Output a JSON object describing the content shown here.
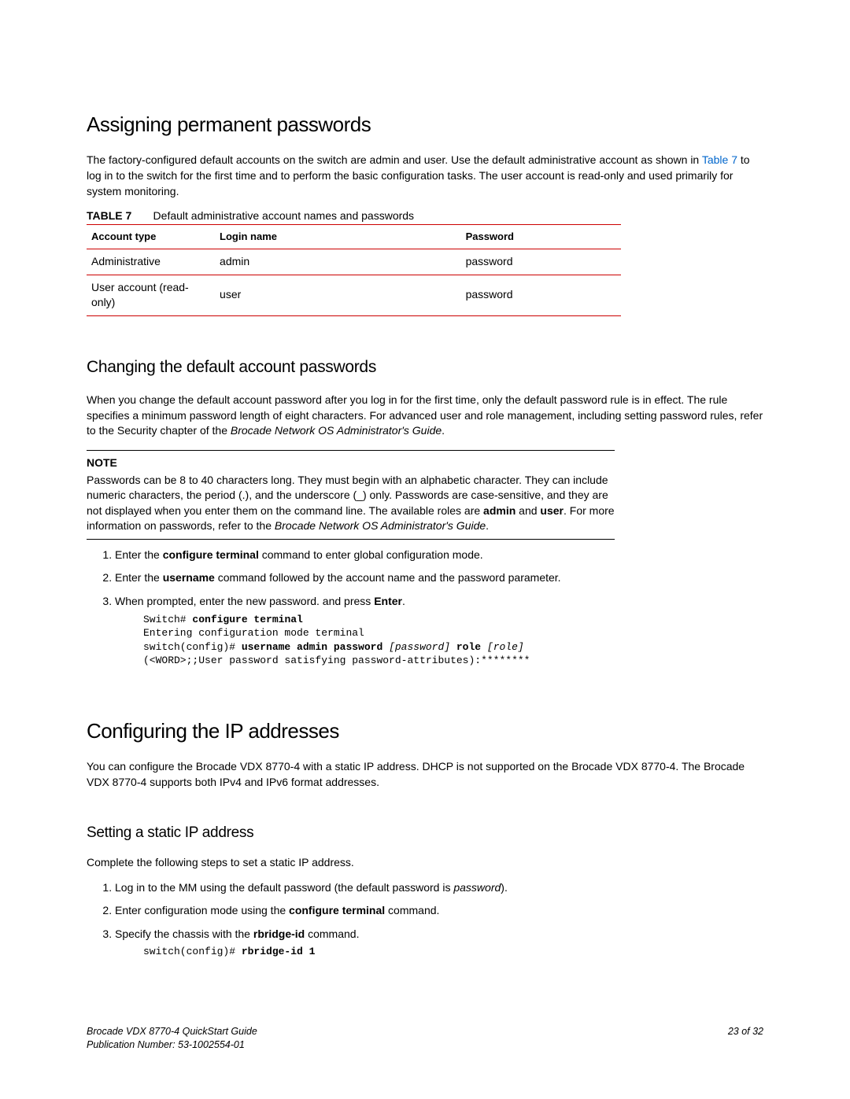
{
  "h1_a": "Assigning permanent passwords",
  "p1_a": "The factory-configured default accounts on the switch are admin and user. Use the default administrative account as shown in ",
  "p1_link": "Table 7",
  "p1_b": " to log in to the switch for the first time and to perform the basic configuration tasks. The user account is read-only and used primarily for system monitoring.",
  "table": {
    "label": "TABLE 7",
    "caption": "Default administrative account names and passwords",
    "headers": [
      "Account type",
      "Login name",
      "Password"
    ],
    "rows": [
      [
        "Administrative",
        "admin",
        "password"
      ],
      [
        "User account (read-only)",
        "user",
        "password"
      ]
    ]
  },
  "h2_a": "Changing the default account passwords",
  "p2_a": "When you change the default account password after you log in for the first time, only the default password rule is in effect. The rule specifies a minimum password length of eight characters. For advanced user and role management, including setting password rules, refer to the Security chapter of the ",
  "p2_i": "Brocade Network OS Administrator's Guide",
  "p2_b": ".",
  "note": {
    "label": "NOTE",
    "a": "Passwords can be 8 to 40 characters long. They must begin with an alphabetic character. They can include numeric characters, the period (.), and the underscore (_) only. Passwords are case-sensitive, and they are not displayed when you enter them on the command line. The available roles are ",
    "b1": "admin",
    "mid": " and ",
    "b2": "user",
    "c": ". For more information on passwords, refer to the ",
    "i": "Brocade Network OS Administrator's Guide",
    "d": "."
  },
  "steps1": {
    "s1a": "Enter the ",
    "s1b": "configure terminal",
    "s1c": " command to enter global configuration mode.",
    "s2a": "Enter the ",
    "s2b": "username",
    "s2c": " command followed by the account name and the password parameter.",
    "s3a": "When prompted, enter the new password. and press ",
    "s3b": "Enter",
    "s3c": "."
  },
  "code1": {
    "l1a": "Switch# ",
    "l1b": "configure terminal",
    "l2": "Entering configuration mode terminal",
    "l3a": "switch(config)# ",
    "l3b": "username admin password ",
    "l3c": "[password]",
    "l3d": " role ",
    "l3e": "[role]",
    "l4": "(<WORD>;;User password satisfying password-attributes):********"
  },
  "h1_b": "Configuring the IP addresses",
  "p3": "You can configure the Brocade VDX 8770-4 with a static IP address. DHCP is not supported on the Brocade VDX 8770-4. The Brocade VDX 8770-4 supports both IPv4 and IPv6 format addresses.",
  "h3_a": "Setting a static IP address",
  "p4": "Complete the following steps to set a static IP address.",
  "steps2": {
    "s1a": "Log in to the MM using the default password (the default password is ",
    "s1i": "password",
    "s1b": ").",
    "s2a": "Enter configuration mode using the ",
    "s2b": "configure terminal",
    "s2c": " command.",
    "s3a": "Specify the chassis with the ",
    "s3b": "rbridge-id",
    "s3c": " command."
  },
  "code2": {
    "l1a": "switch(config)# ",
    "l1b": "rbridge-id 1"
  },
  "footer": {
    "title": "Brocade VDX 8770-4 QuickStart Guide",
    "pub": "Publication Number: 53-1002554-01",
    "page": "23 of 32"
  }
}
